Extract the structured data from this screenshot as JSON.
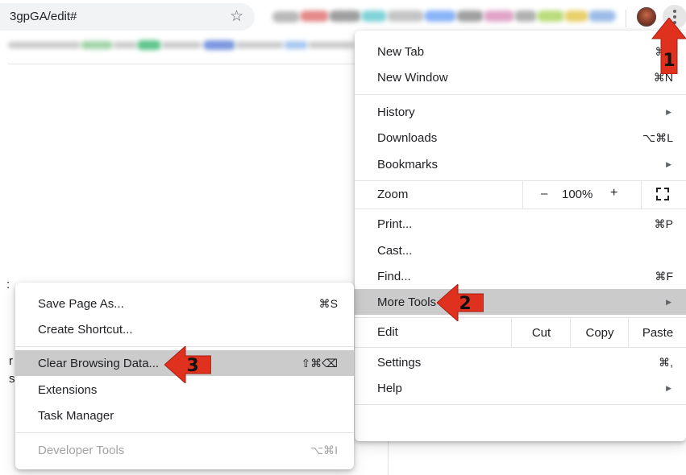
{
  "browser": {
    "url": "3gpGA/edit#",
    "star_icon": "star-outline-icon",
    "avatar_icon": "profile-avatar-icon",
    "menu_icon": "kebab-menu-icon"
  },
  "main_menu": {
    "new_tab": {
      "label": "New Tab",
      "shortcut": "⌘T"
    },
    "new_window": {
      "label": "New Window",
      "shortcut": "⌘N"
    },
    "history": {
      "label": "History"
    },
    "downloads": {
      "label": "Downloads",
      "shortcut": "⌥⌘L"
    },
    "bookmarks": {
      "label": "Bookmarks"
    },
    "zoom": {
      "label": "Zoom",
      "minus": "–",
      "value": "100%",
      "plus": "+"
    },
    "print": {
      "label": "Print...",
      "shortcut": "⌘P"
    },
    "cast": {
      "label": "Cast..."
    },
    "find": {
      "label": "Find...",
      "shortcut": "⌘F"
    },
    "more_tools": {
      "label": "More Tools"
    },
    "edit": {
      "label": "Edit",
      "cut": "Cut",
      "copy": "Copy",
      "paste": "Paste"
    },
    "settings": {
      "label": "Settings",
      "shortcut": "⌘,"
    },
    "help": {
      "label": "Help"
    }
  },
  "sub_menu": {
    "save_page": {
      "label": "Save Page As...",
      "shortcut": "⌘S"
    },
    "create_shortcut": {
      "label": "Create Shortcut..."
    },
    "clear_data": {
      "label": "Clear Browsing Data...",
      "shortcut": "⇧⌘⌫"
    },
    "extensions": {
      "label": "Extensions"
    },
    "task_manager": {
      "label": "Task Manager"
    },
    "dev_tools": {
      "label": "Developer Tools",
      "shortcut": "⌥⌘I"
    }
  },
  "annotations": {
    "step1": "1",
    "step2": "2",
    "step3": "3"
  },
  "colors": {
    "highlight": "#cbcbcb",
    "arrow": "#e0301e",
    "menu_bg": "#ffffff"
  }
}
